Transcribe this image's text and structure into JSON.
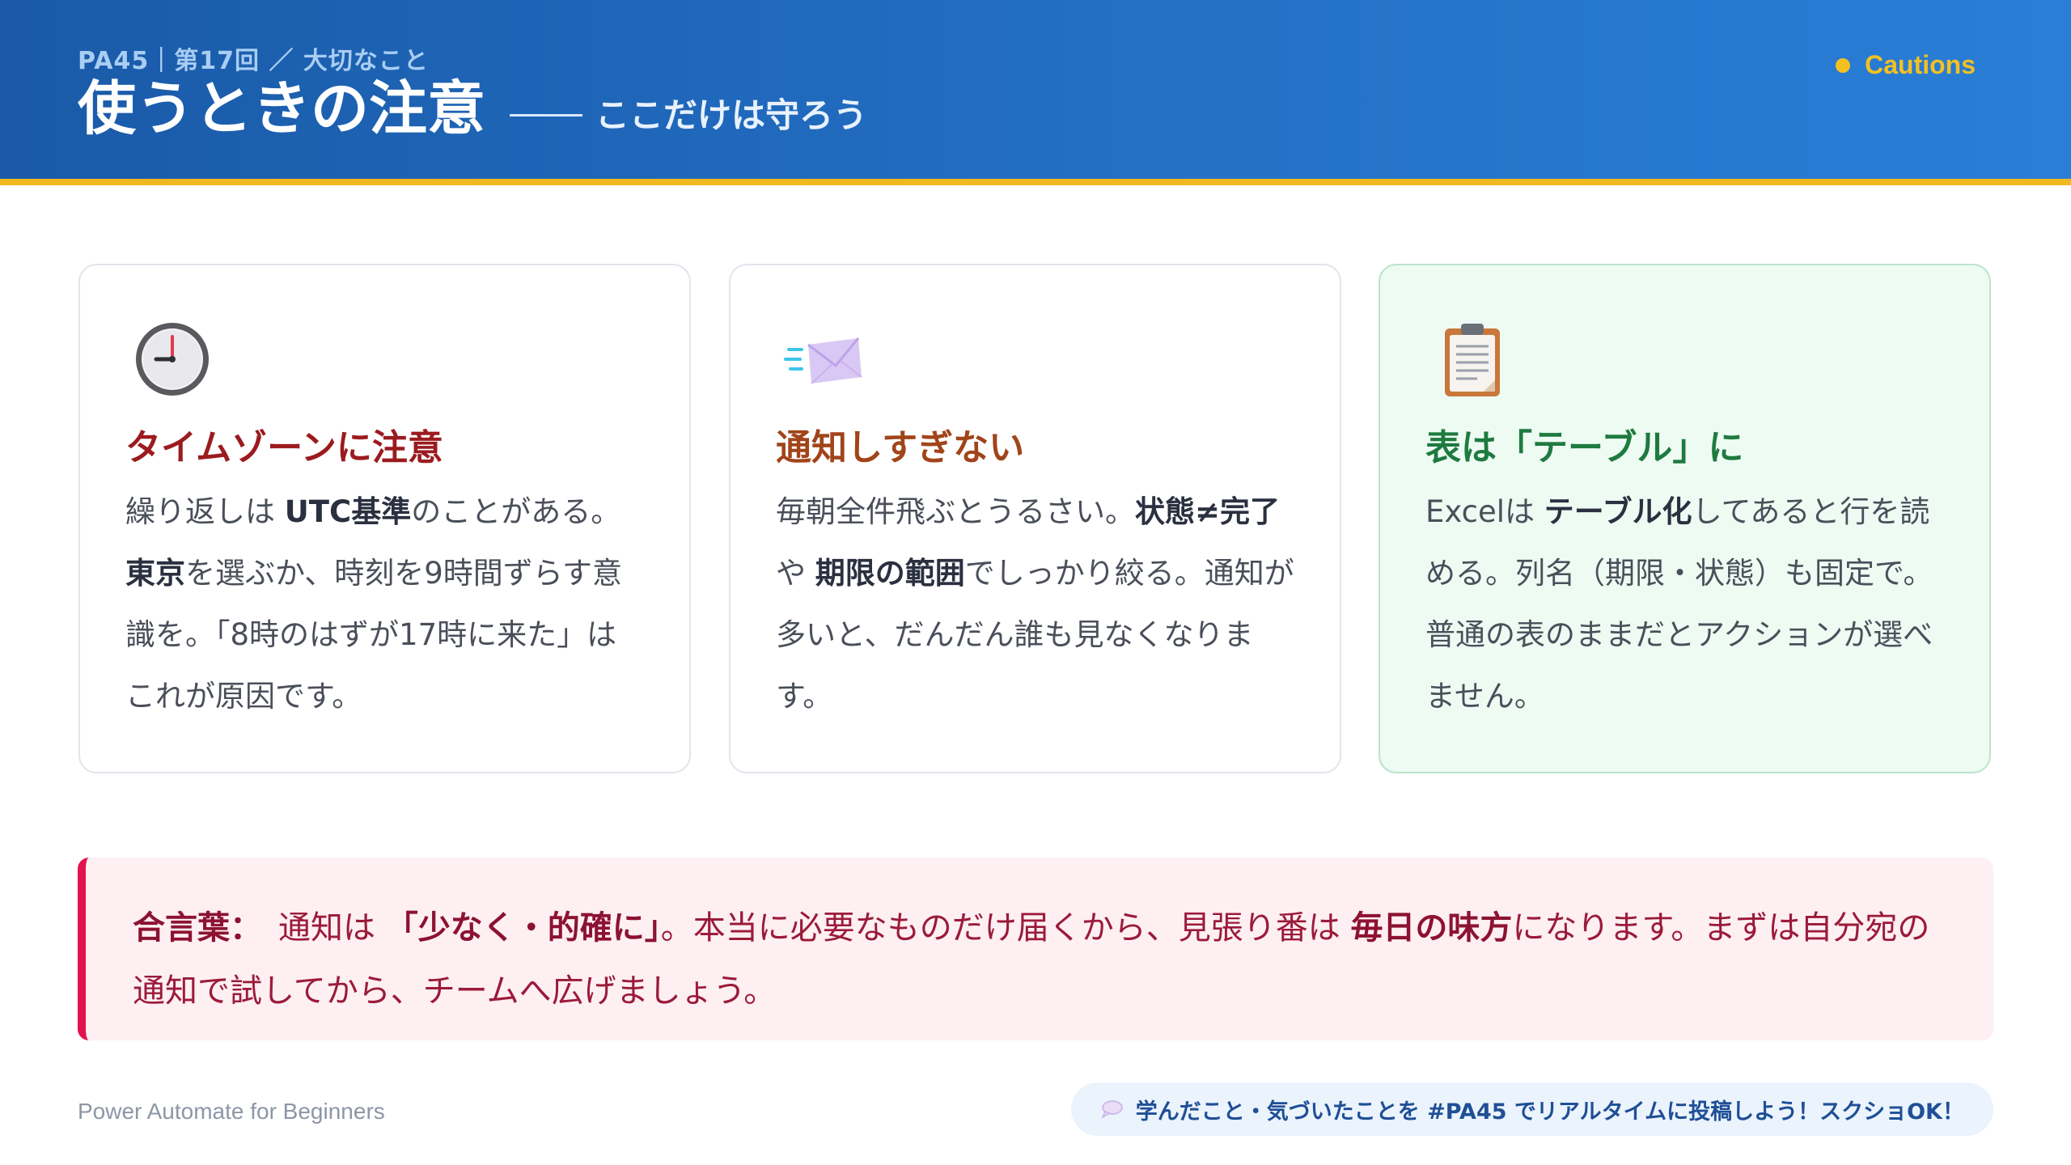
{
  "header": {
    "breadcrumb": "PA45｜第17回 ／ 大切なこと",
    "title": "使うときの注意",
    "subtitle": "ここだけは守ろう",
    "badge": "Cautions"
  },
  "cards": [
    {
      "icon": "clock-icon",
      "title": "タイムゾーンに注意",
      "body": [
        "繰り返しは ",
        "UTC基準",
        "のことがある。",
        "東京",
        "を選ぶか、時刻を9時間ずらす意識を。「8時のはずが17時に来た」はこれが原因です。"
      ]
    },
    {
      "icon": "envelope-icon",
      "title": "通知しすぎない",
      "body": [
        "毎朝全件飛ぶとうるさい。",
        "状態≠完了",
        " や ",
        "期限の範囲",
        "でしっかり絞る。通知が多いと、だんだん誰も見なくなります。"
      ]
    },
    {
      "icon": "clipboard-icon",
      "title": "表は「テーブル」に",
      "body": [
        "Excelは ",
        "テーブル化",
        "してあると行を読める。列名（期限・状態）も固定で。普通の表のままだとアクションが選べません。"
      ]
    }
  ],
  "callout": {
    "label": "合言葉：",
    "parts": [
      "通知は ",
      "「少なく・的確に」",
      "。本当に必要なものだけ届くから、見張り番は ",
      "毎日の味方",
      "になります。まずは自分宛の通知で試してから、チームへ広げましょう。"
    ]
  },
  "footer": {
    "left": "Power Automate for Beginners",
    "pill_icon": "speech-bubble-icon",
    "pill_text": "学んだこと・気づいたことを #PA45 でリアルタイムに投稿しよう！スクショOK！"
  },
  "colors": {
    "header_start": "#1a5aa8",
    "header_end": "#2a7ed6",
    "accent_bar": "#f1b820",
    "badge": "#f4c020",
    "callout_accent": "#e3134f"
  }
}
